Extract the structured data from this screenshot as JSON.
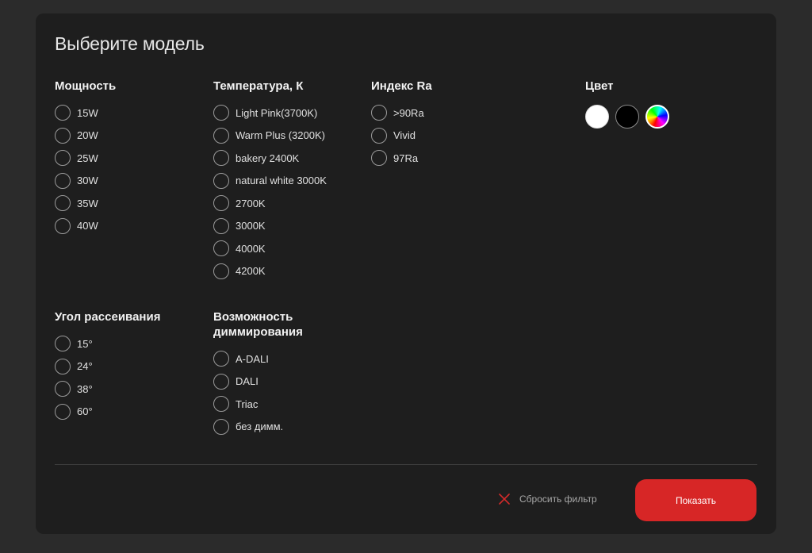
{
  "panel": {
    "title": "Выберите модель"
  },
  "filters": {
    "power": {
      "title": "Мощность",
      "options": [
        "15W",
        "20W",
        "25W",
        "30W",
        "35W",
        "40W"
      ]
    },
    "temperature": {
      "title": "Температура, К",
      "options": [
        "Light Pink(3700K)",
        "Warm Plus (3200K)",
        "bakery 2400K",
        "natural white 3000K",
        "2700K",
        "3000K",
        "4000K",
        "4200K"
      ]
    },
    "ra_index": {
      "title": "Индекс Ra",
      "options": [
        ">90Ra",
        "Vivid",
        "97Ra"
      ]
    },
    "color": {
      "title": "Цвет",
      "swatches": [
        {
          "name": "white",
          "color": "#ffffff"
        },
        {
          "name": "black",
          "color": "#000000"
        },
        {
          "name": "multicolor",
          "color": "rainbow"
        }
      ]
    },
    "beam_angle": {
      "title": "Угол рассеивания",
      "options": [
        "15°",
        "24°",
        "38°",
        "60°"
      ]
    },
    "dimming": {
      "title": "Возможность диммирования",
      "options": [
        "A-DALI",
        "DALI",
        "Triac",
        "без димм."
      ]
    }
  },
  "footer": {
    "reset_label": "Сбросить фильтр",
    "reset_icon": "close-icon",
    "reset_icon_color": "#d32a2a",
    "show_label": "Показать",
    "show_color": "#d72626"
  },
  "colors": {
    "page_bg": "#2b2b2b",
    "panel_bg": "#1e1e1e",
    "accent": "#d72626"
  }
}
